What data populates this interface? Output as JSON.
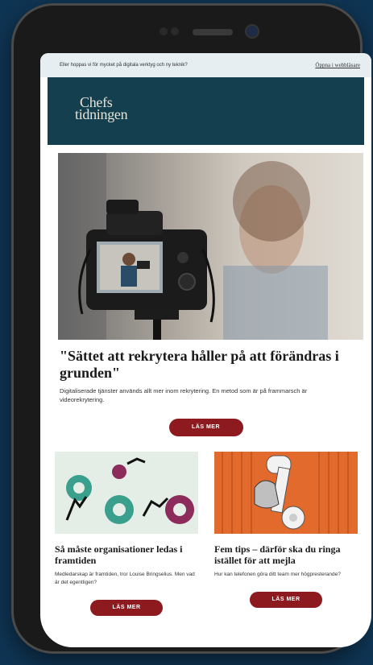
{
  "preheader": {
    "text": "Eller hoppas vi för mycket på digitala verktyg och ny teknik?",
    "browser_link": "Öppna i webbläsare"
  },
  "masthead": {
    "logo_line1": "Chefs",
    "logo_line2": "tidningen",
    "bg_color": "#143f4f"
  },
  "main_article": {
    "image_icon": "camera-recording-photo",
    "title": "\"Sättet att rekrytera håller på att förändras i grunden\"",
    "description": "Digitaliserade tjänster används allt mer inom rekrytering. En metod som är på frammarsch är videorekrytering.",
    "button_label": "LÄS MER"
  },
  "articles": [
    {
      "image_icon": "gears-collage",
      "title": "Så måste organisationer ledas i framtiden",
      "description": "Medledarskap är framtiden, tror Louise Bringselius. Men vad är det egentligen?",
      "button_label": "LÄS MER"
    },
    {
      "image_icon": "phone-handset",
      "title": "Fem tips – därför ska du ringa istället för att mejla",
      "description": "Hur kan telefonen göra ditt team mer högpresterande?",
      "button_label": "LÄS MER"
    }
  ],
  "colors": {
    "accent_button": "#8c1a1f",
    "background": "#0f3554"
  }
}
